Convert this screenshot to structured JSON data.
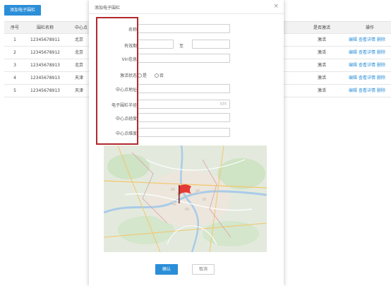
{
  "page": {
    "add_button_label": "添加电子围栏",
    "table": {
      "headers": {
        "no": "序号",
        "name": "围栏名称",
        "center": "中心点",
        "status": "是否激活",
        "ops": "操作"
      },
      "rows": [
        {
          "no": "1",
          "name": "12345678911",
          "center": "北京",
          "status": "激活"
        },
        {
          "no": "2",
          "name": "12345678912",
          "center": "北京",
          "status": "激活"
        },
        {
          "no": "3",
          "name": "12345678913",
          "center": "北京",
          "status": "激活"
        },
        {
          "no": "4",
          "name": "12345678913",
          "center": "天津",
          "status": "激活"
        },
        {
          "no": "5",
          "name": "12345678913",
          "center": "天津",
          "status": "激活"
        }
      ],
      "ops": {
        "edit": "编辑",
        "details": "查看详情",
        "delete": "删除"
      }
    }
  },
  "modal": {
    "title": "添加电子围栏",
    "close_symbol": "×",
    "fields": {
      "name": {
        "label": "名称",
        "value": ""
      },
      "validity": {
        "label": "有效期",
        "separator": "至",
        "start": "",
        "end": ""
      },
      "vin": {
        "label": "Vin信息",
        "value": ""
      },
      "activation": {
        "label": "激活状态",
        "yes": "是",
        "no": "否"
      },
      "center_address": {
        "label": "中心点地址",
        "value": ""
      },
      "radius": {
        "label": "电子围栏半径",
        "unit": "KM",
        "value": ""
      },
      "center_lon": {
        "label": "中心点经度",
        "value": ""
      },
      "center_lat": {
        "label": "中心点维度",
        "value": ""
      }
    },
    "confirm_label": "确认",
    "cancel_label": "取消"
  },
  "colors": {
    "accent": "#2b8ed8",
    "highlight": "#b3282d",
    "flag": "#e53935"
  },
  "icons": [
    "close-icon",
    "flag-icon"
  ]
}
